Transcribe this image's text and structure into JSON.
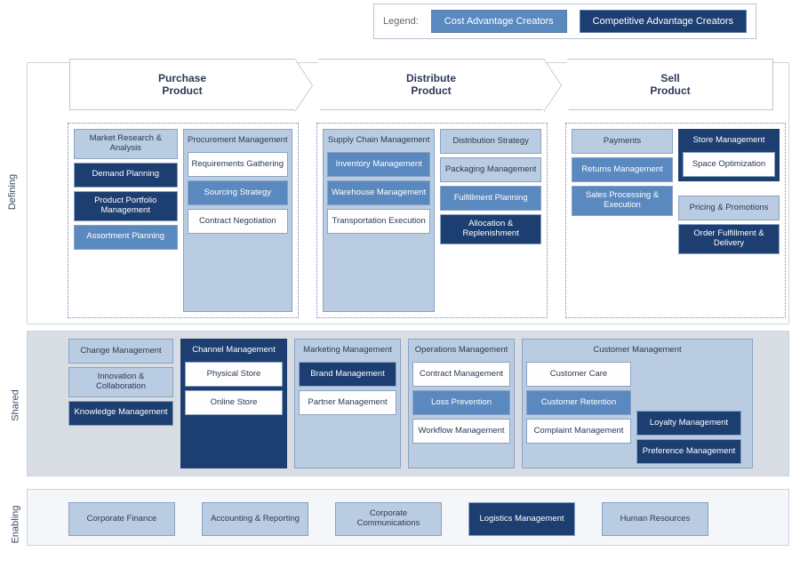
{
  "legend": {
    "label": "Legend:",
    "cost": "Cost Advantage Creators",
    "comp": "Competitive Advantage Creators"
  },
  "rows": {
    "defining": "Defining",
    "shared": "Shared",
    "enabling": "Enabling"
  },
  "chevrons": {
    "c1a": "Purchase",
    "c1b": "Product",
    "c2a": "Distribute",
    "c2b": "Product",
    "c3a": "Sell",
    "c3b": "Product"
  },
  "purchase": {
    "left": {
      "h": "Market Research & Analysis",
      "a": "Demand Planning",
      "b": "Product Portfolio Management",
      "c": "Assortment Planning"
    },
    "right": {
      "h": "Procurement Management",
      "a": "Requirements Gathering",
      "b": "Sourcing Strategy",
      "c": "Contract Negotiation"
    }
  },
  "distribute": {
    "left": {
      "h": "Supply Chain Management",
      "a": "Inventory Management",
      "b": "Warehouse Management",
      "c": "Transportation Execution"
    },
    "right": {
      "h": "Distribution Strategy",
      "a": "Packaging Management",
      "b": "Fulfillment Planning",
      "c": "Allocation & Replenishment"
    }
  },
  "sell": {
    "left": {
      "a": "Payments",
      "b": "Returns Management",
      "c": "Sales Processing & Execution"
    },
    "right": {
      "h": "Store Management",
      "a": "Space Optimization",
      "b": "Pricing & Promotions",
      "c": "Order Fulfillment & Delivery"
    }
  },
  "shared": {
    "s1a": "Change Management",
    "s1b": "Innovation & Collaboration",
    "s1c": "Knowledge Management",
    "s2h": "Channel Management",
    "s2a": "Physical Store",
    "s2b": "Online Store",
    "s3h": "Marketing Management",
    "s3a": "Brand Management",
    "s3b": "Partner Management",
    "s4h": "Operations Management",
    "s4a": "Contract Management",
    "s4b": "Loss Prevention",
    "s4c": "Workflow Management",
    "s5h": "Customer Management",
    "s5a": "Customer Care",
    "s5b": "Customer Retention",
    "s5c": "Complaint Management",
    "s5d": "Loyalty Management",
    "s5e": "Preference Management"
  },
  "enabling": {
    "a": "Corporate Finance",
    "b": "Accounting & Reporting",
    "c": "Corporate Communications",
    "d": "Logistics Management",
    "e": "Human Resources"
  }
}
